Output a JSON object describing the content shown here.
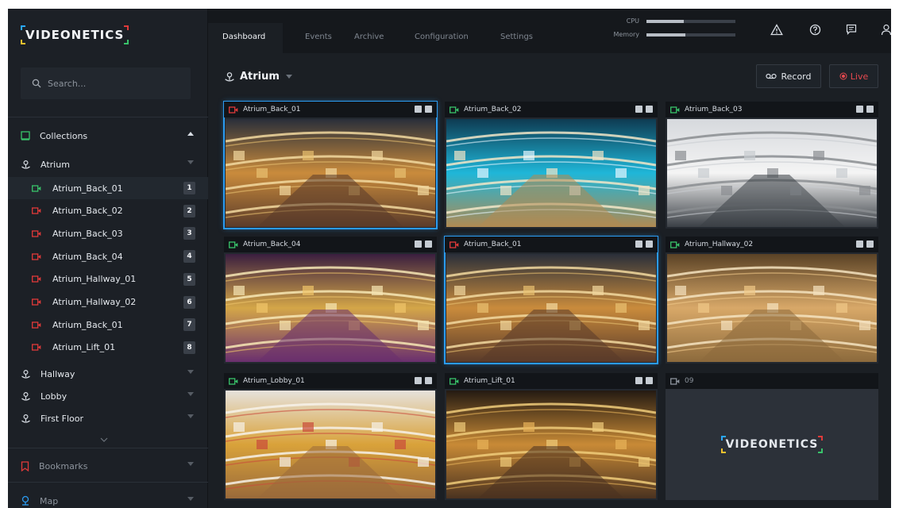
{
  "brand": {
    "name": "VIDEONETICS"
  },
  "search": {
    "placeholder": "Search..."
  },
  "sidebar": {
    "collections_label": "Collections",
    "group_label": "Atrium",
    "cameras": [
      {
        "name": "Atrium_Back_01",
        "num": "1",
        "status": "online"
      },
      {
        "name": "Atrium_Back_02",
        "num": "2",
        "status": "offline"
      },
      {
        "name": "Atrium_Back_03",
        "num": "3",
        "status": "offline"
      },
      {
        "name": "Atrium_Back_04",
        "num": "4",
        "status": "offline"
      },
      {
        "name": "Atrium_Hallway_01",
        "num": "5",
        "status": "offline"
      },
      {
        "name": "Atrium_Hallway_02",
        "num": "6",
        "status": "offline"
      },
      {
        "name": "Atrium_Back_01",
        "num": "7",
        "status": "offline"
      },
      {
        "name": "Atrium_Lift_01",
        "num": "8",
        "status": "offline"
      }
    ],
    "other_groups": [
      "Hallway",
      "Lobby",
      "First Floor"
    ],
    "bookmarks_label": "Bookmarks",
    "map_label": "Map"
  },
  "tabs": [
    "Dashboard",
    "Events",
    "Archive",
    "Configuration",
    "Settings"
  ],
  "meters": {
    "cpu_label": "CPU",
    "cpu_level": 0.42,
    "memory_label": "Memory",
    "memory_level": 0.44
  },
  "main": {
    "title": "Atrium",
    "record_label": "Record",
    "live_label": "Live"
  },
  "tiles": [
    {
      "name": "Atrium_Back_01",
      "status": "offline",
      "selected": true
    },
    {
      "name": "Atrium_Back_02",
      "status": "online",
      "selected": false
    },
    {
      "name": "Atrium_Back_03",
      "status": "online",
      "selected": false
    },
    {
      "name": "Atrium_Back_04",
      "status": "online",
      "selected": false
    },
    {
      "name": "Atrium_Back_01",
      "status": "offline",
      "selected": true
    },
    {
      "name": "Atrium_Hallway_02",
      "status": "online",
      "selected": false
    },
    {
      "name": "Atrium_Lobby_01",
      "status": "online",
      "selected": false
    },
    {
      "name": "Atrium_Lift_01",
      "status": "online",
      "selected": false
    },
    {
      "name": "09",
      "status": "empty",
      "selected": false
    }
  ],
  "colors": {
    "online": "#39c36a",
    "offline": "#e03a3a",
    "accent": "#2b9bf0",
    "live": "#e8494f"
  },
  "icons": {
    "search": "search-icon",
    "collections": "collections-icon",
    "location": "location-pin-icon",
    "camera": "camera-icon",
    "bookmark": "bookmark-icon",
    "map": "map-pin-icon",
    "alert": "alert-icon",
    "help": "help-icon",
    "chat": "chat-icon",
    "user": "user-icon",
    "record": "record-icon",
    "live": "live-dot-icon"
  }
}
